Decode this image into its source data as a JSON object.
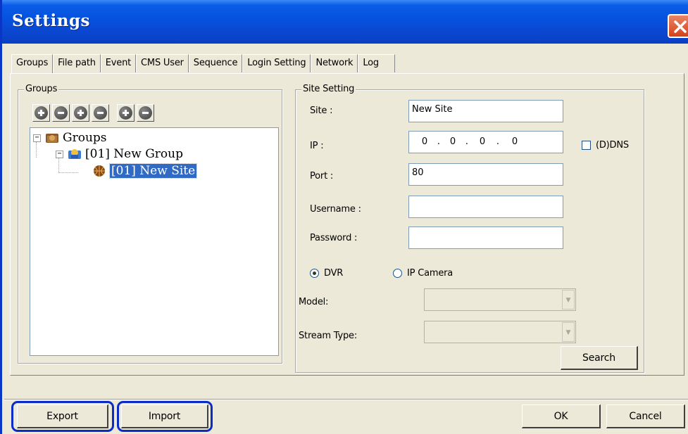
{
  "window": {
    "title": "Settings"
  },
  "tabs": [
    {
      "label": "Groups"
    },
    {
      "label": "File path"
    },
    {
      "label": "Event"
    },
    {
      "label": "CMS User"
    },
    {
      "label": "Sequence"
    },
    {
      "label": "Login Setting"
    },
    {
      "label": "Network"
    },
    {
      "label": "Log"
    }
  ],
  "groups_panel": {
    "label": "Groups",
    "toolbar_icons": [
      "add-group-icon",
      "remove-group-icon",
      "add-site-icon",
      "remove-site-icon",
      "move-up-icon",
      "move-down-icon"
    ],
    "tree": {
      "root": {
        "label": "Groups",
        "toggle": "−"
      },
      "group": {
        "label": "[01] New Group",
        "toggle": "−"
      },
      "site": {
        "label": "[01] New Site"
      }
    }
  },
  "site_setting": {
    "label": "Site Setting",
    "site_label": "Site :",
    "site_value": "New Site",
    "ip_label": "IP :",
    "ip_segments": [
      "0",
      "0",
      "0",
      "0"
    ],
    "ip_dot": ".",
    "ddns_label": "(D)DNS",
    "port_label": "Port :",
    "port_value": "80",
    "username_label": "Username :",
    "username_value": "",
    "password_label": "Password :",
    "password_value": "",
    "dvr_label": "DVR",
    "ipcam_label": "IP Camera",
    "model_label": "Model:",
    "stream_label": "Stream Type:",
    "combo_arrow": "▼",
    "search_label": "Search"
  },
  "footer": {
    "export_label": "Export",
    "import_label": "Import",
    "ok_label": "OK",
    "cancel_label": "Cancel"
  },
  "colors": {
    "titlebar": "#0553df",
    "highlight_border": "#0b2cc7",
    "selection": "#316ac5"
  }
}
